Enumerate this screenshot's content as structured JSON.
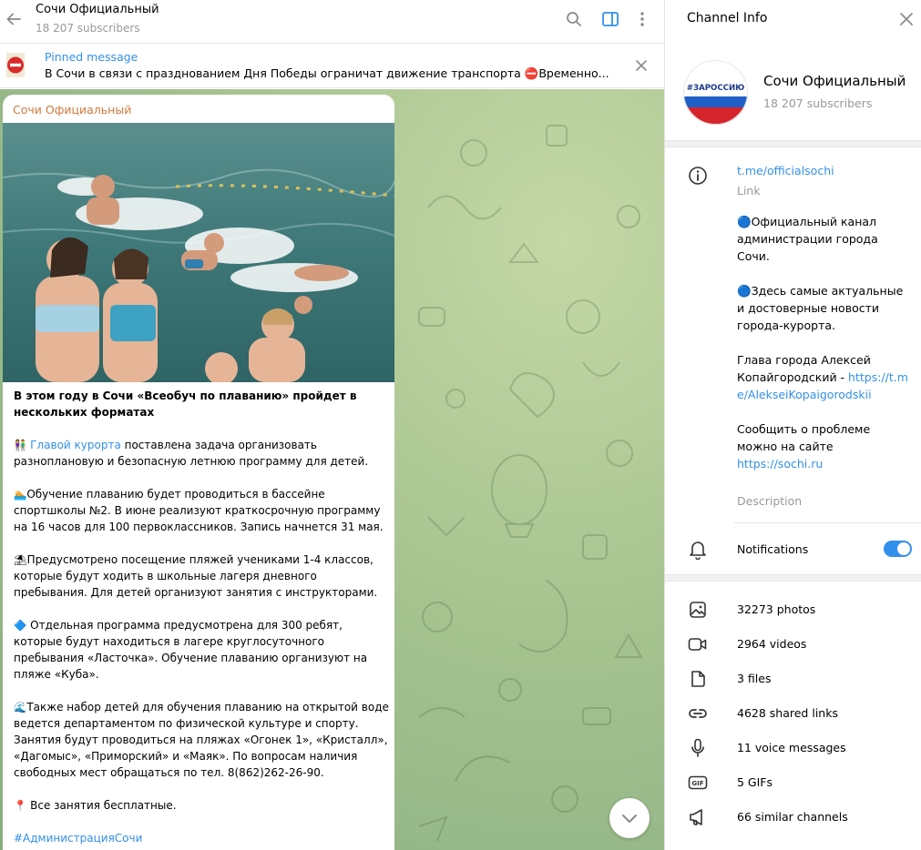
{
  "chat_header": {
    "title": "Сочи Официальный",
    "subscribers": "18 207 subscribers"
  },
  "pinned": {
    "title": "Pinned message",
    "text": "В Сочи в связи с празднованием Дня Победы ограничат движение транспорта ⛔Временно..."
  },
  "post": {
    "author": "Сочи Официальный",
    "headline": "В этом году в Сочи «Всеобуч по плаванию» пройдет в нескольких форматах",
    "p1_emoji": "👫",
    "p1_link": "Главой курорта",
    "p1_rest": " поставлена задача организовать разноплановую и безопасную летнюю программу для детей.",
    "p2_emoji": "🏊",
    "p2_text": "Обучение плаванию будет проводиться в бассейне спортшколы №2. В июне реализуют краткосрочную программу на 16 часов для 100 первоклассников. Запись начнется 31 мая.",
    "p3_emoji": "⛱",
    "p3_text": "Предусмотрено посещение пляжей учениками 1-4 классов, которые будут ходить в школьные лагеря дневного пребывания. Для детей организуют занятия с инструкторами.",
    "p4_emoji": "🔷",
    "p4_text": " Отдельная программа предусмотрена для 300 ребят, которые будут находиться в лагере круглосуточного пребывания «Ласточка». Обучение плаванию организуют на пляже «Куба».",
    "p5_emoji": "🌊",
    "p5_text": "Также набор детей для обучения плаванию на открытой воде ведется департаментом по физической культуре и спорту. Занятия будут проводиться на пляжах «Огонек 1», «Кристалл», «Дагомыс», «Приморский» и «Маяк». По вопросам наличия свободных мест обращаться по тел. 8(862)262-26-90.",
    "p6_emoji": "📍",
    "p6_text": " Все занятия бесплатные.",
    "hashtag": "#АдминистрацияСочи"
  },
  "info": {
    "title": "Channel Info",
    "avatar_text": "#ЗАРОССИЮ",
    "name": "Сочи Официальный",
    "subscribers": "18 207 subscribers",
    "link": "t.me/officialsochi",
    "link_label": "Link",
    "desc_p1": "🔵Официальный канал администрации города Сочи.",
    "desc_p2": "🔵Здесь самые актуальные и достоверные новости города-курорта.",
    "desc_p3_text": "Глава города Алексей Копайгородский - ",
    "desc_p3_link": "https://t.me/AlekseiKopaigorodskii",
    "desc_p4_text": "Сообщить о проблеме можно на сайте ",
    "desc_p4_link": "https://sochi.ru",
    "desc_label": "Description",
    "notifications_label": "Notifications",
    "notifications_on": true,
    "media": [
      {
        "label": "32273 photos",
        "icon": "photo-icon"
      },
      {
        "label": "2964 videos",
        "icon": "video-icon"
      },
      {
        "label": "3 files",
        "icon": "file-icon"
      },
      {
        "label": "4628 shared links",
        "icon": "link-icon"
      },
      {
        "label": "11 voice messages",
        "icon": "microphone-icon"
      },
      {
        "label": "5 GIFs",
        "icon": "gif-icon"
      },
      {
        "label": "66 similar channels",
        "icon": "megaphone-icon"
      }
    ]
  },
  "colors": {
    "accent": "#3390ec",
    "author": "#d1793d",
    "muted": "#999999",
    "chat_bg": "#a6c38f"
  }
}
